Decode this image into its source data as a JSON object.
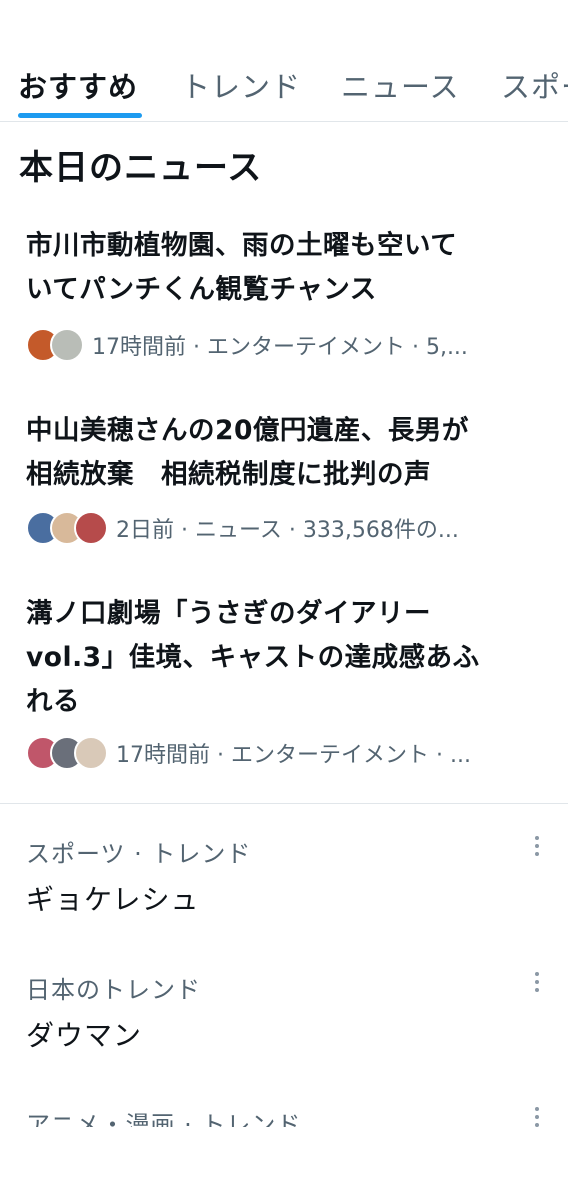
{
  "tabs": [
    {
      "label": "おすすめ"
    },
    {
      "label": "トレンド"
    },
    {
      "label": "ニュース"
    },
    {
      "label": "スポー"
    }
  ],
  "section": {
    "title": "本日のニュース"
  },
  "news": [
    {
      "title_line1": "市川市動植物園、雨の土曜も空いて",
      "title_line2": "いてパンチくん観覧チャンス",
      "meta": "17時間前 · エンターテイメント · 5,...",
      "avatar_colors": [
        "#c45a2a",
        "#b9bdb7"
      ]
    },
    {
      "title_line1": "中山美穂さんの20億円遺産、長男が",
      "title_line2": "相続放棄　相続税制度に批判の声",
      "meta": "2日前 · ニュース · 333,568件の...",
      "avatar_colors": [
        "#4a6ea0",
        "#d8b99a",
        "#b64b4b"
      ]
    },
    {
      "title_line1": "溝ノ口劇場「うさぎのダイアリー",
      "title_line2": "vol.3」佳境、キャストの達成感あふ",
      "title_line3": "れる",
      "meta": "17時間前 · エンターテイメント · ...",
      "avatar_colors": [
        "#c0566a",
        "#6a6f7a",
        "#d9c9b8"
      ]
    }
  ],
  "trends": [
    {
      "category": "スポーツ · トレンド",
      "name": "ギョケレシュ"
    },
    {
      "category": "日本のトレンド",
      "name": "ダウマン"
    },
    {
      "category": "アニメ・漫画 · トレンド",
      "name": ""
    }
  ],
  "colors": {
    "accent": "#1d9bf0",
    "secondary_text": "#536471",
    "divider": "#e1e6ea"
  },
  "icons": {
    "more": "more-vertical-icon"
  }
}
